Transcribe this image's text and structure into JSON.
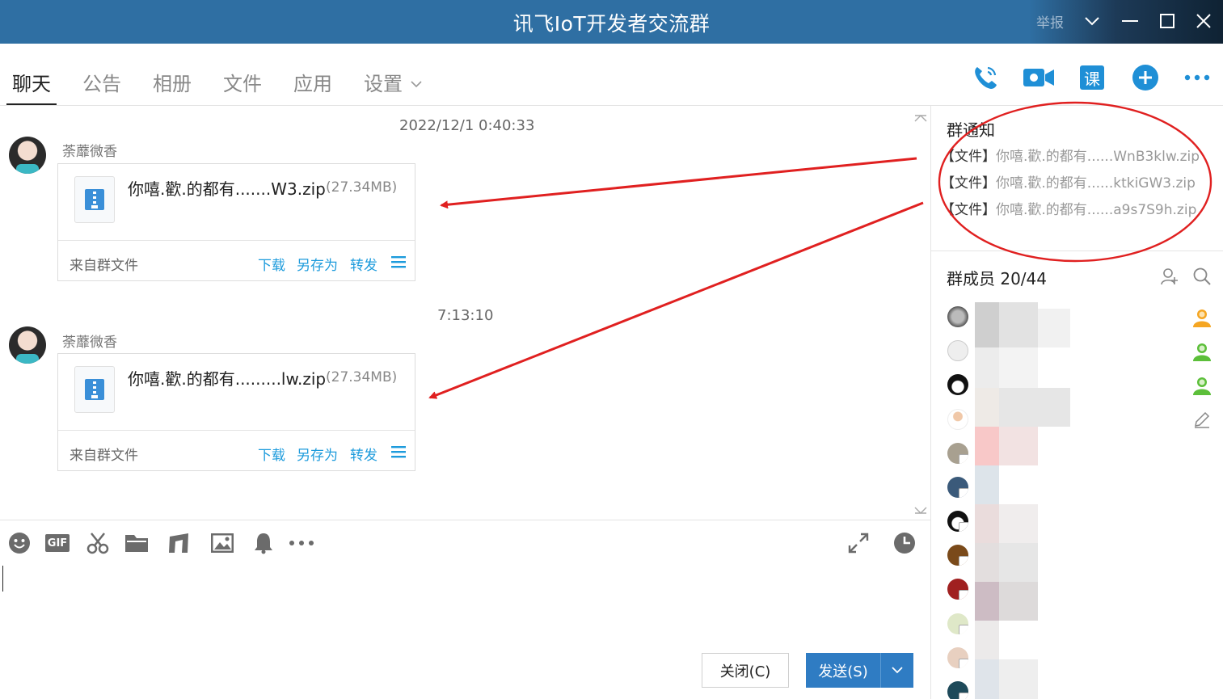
{
  "window": {
    "title": "讯飞IoT开发者交流群",
    "report_label": "举报"
  },
  "tabs": [
    {
      "label": "聊天",
      "active": true
    },
    {
      "label": "公告",
      "active": false
    },
    {
      "label": "相册",
      "active": false
    },
    {
      "label": "文件",
      "active": false
    },
    {
      "label": "应用",
      "active": false
    },
    {
      "label": "设置",
      "active": false
    }
  ],
  "toolbar": {
    "icons": [
      "phone-call-icon",
      "video-call-icon",
      "course-icon",
      "add-circle-icon",
      "more-icon"
    ],
    "course_label": "课"
  },
  "chat": {
    "messages": [
      {
        "timestamp": "2022/12/1 0:40:33",
        "sender": "荼蘼微香",
        "file_name": "你嘻.歡.的都有.......W3.zip",
        "file_size": "(27.34MB)",
        "source": "来自群文件",
        "actions": [
          "下载",
          "另存为",
          "转发"
        ]
      },
      {
        "timestamp": "7:13:10",
        "sender": "荼蘼微香",
        "file_name": "你嘻.歡.的都有.........lw.zip",
        "file_size": "(27.34MB)",
        "source": "来自群文件",
        "actions": [
          "下载",
          "另存为",
          "转发"
        ]
      }
    ]
  },
  "input": {
    "toolbar_icons": [
      "emoji-icon",
      "gif-icon",
      "scissors-icon",
      "folder-icon",
      "music-icon",
      "image-icon",
      "bell-icon",
      "more-icon",
      "expand-icon",
      "history-icon"
    ],
    "gif_label": "GIF",
    "close_button": "关闭(C)",
    "send_button": "发送(S)"
  },
  "notice": {
    "title": "群通知",
    "items": [
      {
        "tag": "【文件】",
        "name": "你嘻.歡.的都有......WnB3klw.zip"
      },
      {
        "tag": "【文件】",
        "name": "你嘻.歡.的都有......ktkiGW3.zip"
      },
      {
        "tag": "【文件】",
        "name": "你嘻.歡.的都有......a9s7S9h.zip"
      }
    ]
  },
  "members": {
    "title": "群成员 20/44",
    "role_icons": [
      "owner-icon",
      "admin-icon",
      "admin-icon",
      "edit-icon"
    ]
  },
  "colors": {
    "titlebar": "#2f6fa3",
    "accent": "#1d9bdc",
    "send_button": "#2f7cc3",
    "annotation": "#e02020"
  }
}
